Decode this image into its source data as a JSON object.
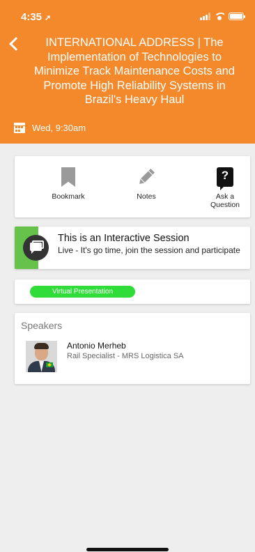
{
  "status_bar": {
    "time": "4:35",
    "location_glyph": "➚"
  },
  "header": {
    "title": "INTERNATIONAL ADDRESS | The Implementation of Technologies to Minimize Track Maintenance Costs and Promote High Reliability Systems in Brazil's Heavy Haul",
    "date_time": "Wed, 9:30am",
    "background_color": "#f4892b"
  },
  "actions": {
    "bookmark": {
      "label": "Bookmark",
      "icon": "bookmark-icon"
    },
    "notes": {
      "label": "Notes",
      "icon": "pencil-icon"
    },
    "ask": {
      "label_line1": "Ask a",
      "label_line2": "Question",
      "icon": "question-icon",
      "icon_glyph": "?"
    }
  },
  "interactive": {
    "title": "This is an Interactive Session",
    "description": "Live - It's go time, join the session and participate",
    "accent_color": "#66c24b"
  },
  "virtual": {
    "label": "Virtual Presentation",
    "color": "#2fdc3a"
  },
  "speakers": {
    "heading": "Speakers",
    "items": [
      {
        "name": "Antonio Merheb",
        "role": "Rail Specialist - MRS Logistica SA"
      }
    ]
  }
}
